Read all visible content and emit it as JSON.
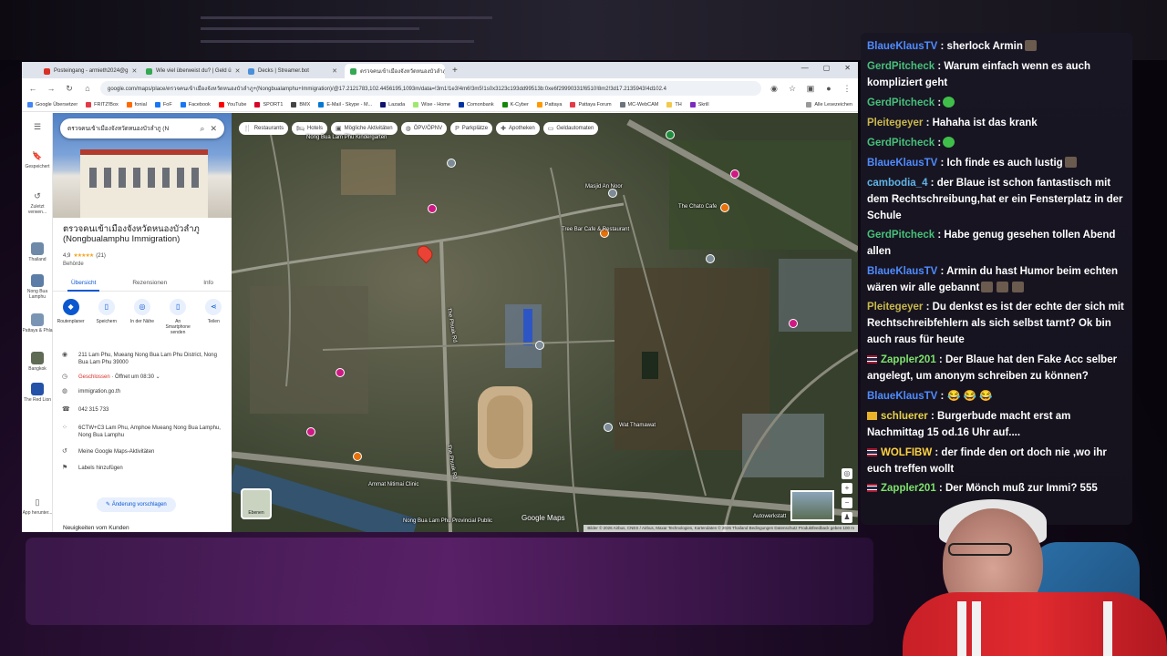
{
  "browser": {
    "tabs": [
      {
        "label": "Posteingang - armieth2024@g",
        "color": "#d93025"
      },
      {
        "label": "Wie viel überweist du? | Geld ü",
        "color": "#34a853"
      },
      {
        "label": "Decks | Streamer.bot",
        "color": "#4a90d9"
      },
      {
        "label": "ตรวจคนเข้าเมืองจังหวัดหนองบัวลำภู",
        "color": "#34a853"
      }
    ],
    "url": "google.com/maps/place/ตรวจคนเข้าเมืองจังหวัดหนองบัวลำภู+(Nongbualamphu+Immigration)/@17.2121783,102.4456195,1093m/data=!3m1!1e3!4m6!3m5!1s0x3123c193dd99513b:0xe6f29990331f6510!8m2!3d17.2135943!4d102.4",
    "bookmarks": [
      "Google Übersetzer",
      "FRITZ!Box",
      "fonial",
      "FoF",
      "Facebook",
      "YouTube",
      "SPORT1",
      "BMX",
      "E-Mail - Skype - M...",
      "Lazada",
      "Wise - Home",
      "Comonbank",
      "K-Cyber",
      "Pattaya",
      "Pattaya Forum",
      "MC-WebCAM",
      "TH",
      "Skrill",
      "Alle Lesezeichen"
    ]
  },
  "maps": {
    "rail": [
      {
        "label": "Gespeichert",
        "icon": "bookmark-icon"
      },
      {
        "label": "Zuletzt verwen...",
        "icon": "history-icon"
      },
      {
        "label": "Thailand",
        "icon": "place-thumb"
      },
      {
        "label": "Nong Bua Lamphu",
        "icon": "place-thumb"
      },
      {
        "label": "Pattaya & Phla",
        "icon": "place-thumb"
      },
      {
        "label": "Bangkok",
        "icon": "place-thumb"
      },
      {
        "label": "The Red Lion",
        "icon": "place-thumb"
      },
      {
        "label": "App herunter...",
        "icon": "phone-icon"
      }
    ],
    "search_query": "ตรวจคนเข้าเมืองจังหวัดหนองบัวลำภู (N",
    "place": {
      "title": "ตรวจคนเข้าเมืองจังหวัดหนองบัวลำภู (Nongbualamphu Immigration)",
      "rating": "4,9",
      "stars": "★★★★★",
      "reviews": "(21)",
      "category": "Behörde",
      "tabs": [
        "Übersicht",
        "Rezensionen",
        "Info"
      ],
      "actions": [
        "Routenplaner",
        "Speichern",
        "In der Nähe",
        "An Smartphone senden",
        "Teilen"
      ],
      "address": "211 Lam Phu, Mueang Nong Bua Lam Phu District, Nong Bua Lam Phu 39000",
      "status_closed": "Geschlossen",
      "status_opens": " · Öffnet um 08:30",
      "website": "immigration.go.th",
      "phone": "042 315 733",
      "pluscode": "6CTW+C3 Lam Phu, Amphoe Mueang Nong Bua Lamphu, Nong Bua Lamphu",
      "activity": "Meine Google Maps-Aktivitäten",
      "labels": "Labels hinzufügen",
      "suggest": "Änderung vorschlagen",
      "nearby": "Neuigkeiten vom Kunden"
    },
    "chips": [
      "Restaurants",
      "Hotels",
      "Mögliche Aktivitäten",
      "ÖPV/ÖPNV",
      "Parkplätze",
      "Apotheken",
      "Geldautomaten"
    ],
    "labels": [
      "Nong Bua Lam Phu Kindergarten",
      "Masjid An Noor",
      "Tree Bar Cafe & Restaurant",
      "The Chato Cafe",
      "Wat Thamawat",
      "Ammat Nitimai Clinic",
      "The Phuak Rd",
      "The Phuak Rd",
      "Nong Bua Lam Phu Provincial Public",
      "Autowerkstatt"
    ],
    "layers_label": "Ebenen",
    "logo": "Google Maps",
    "attribution": "Bilder © 2026 Airbus, CNES / Airbus, Maxar Technologies, Kartendaten © 2026   Thailand   Bedingungen   Datenschutz   Produktfeedback geben   100 m"
  },
  "chat": [
    {
      "user": "BlaueKlausTV",
      "color": "#4f8cff",
      "text": " : sherlock Armin",
      "emotes": 1,
      "flag": false
    },
    {
      "user": "GerdPitcheck",
      "color": "#46c17a",
      "text": " : Warum einfach wenn es auch kompliziert geht",
      "emotes": 0,
      "flag": false
    },
    {
      "user": "GerdPitcheck",
      "color": "#46c17a",
      "text": " :",
      "emotes": 1,
      "flag": false,
      "green": true
    },
    {
      "user": "Pleitegeyer",
      "color": "#c9b84a",
      "text": " : Hahaha ist das krank",
      "emotes": 0,
      "flag": false
    },
    {
      "user": "GerdPitcheck",
      "color": "#46c17a",
      "text": " :",
      "emotes": 1,
      "flag": false,
      "green": true
    },
    {
      "user": "BlaueKlausTV",
      "color": "#4f8cff",
      "text": " : Ich finde es auch lustig",
      "emotes": 1,
      "flag": false
    },
    {
      "user": "cambodia_4",
      "color": "#5fb4e6",
      "text": " : der Blaue ist schon fantastisch mit dem Rechtschreibung,hat er ein Fensterplatz in der Schule",
      "emotes": 0,
      "flag": false
    },
    {
      "user": "GerdPitcheck",
      "color": "#46c17a",
      "text": " : Habe genug gesehen tollen Abend allen",
      "emotes": 0,
      "flag": false
    },
    {
      "user": "BlaueKlausTV",
      "color": "#4f8cff",
      "text": " : Armin du hast Humor beim echten wären wir alle gebannt",
      "emotes": 3,
      "flag": false
    },
    {
      "user": "Pleitegeyer",
      "color": "#c9b84a",
      "text": " : Du denkst es ist der echte der sich mit Rechtschreibfehlern als sich selbst tarnt? Ok bin auch raus für heute",
      "emotes": 0,
      "flag": false
    },
    {
      "user": "Zappler201",
      "color": "#7de36b",
      "text": " : Der Blaue hat den Fake Acc selber angelegt, um anonym schreiben zu können?",
      "emotes": 0,
      "flag": true
    },
    {
      "user": "BlaueKlausTV",
      "color": "#4f8cff",
      "text": " :",
      "emotes": 0,
      "flag": false,
      "laughs": "😂 😂 😂"
    },
    {
      "user": "schluerer",
      "color": "#e8d24a",
      "text": " : Burgerbude macht erst am Nachmittag 15 od.16 Uhr auf....",
      "emotes": 0,
      "flag": false,
      "crown": true
    },
    {
      "user": "WOLFIBW",
      "color": "#ffd23f",
      "text": " : der finde den ort doch nie ,wo ihr euch treffen wollt",
      "emotes": 0,
      "flag": true
    },
    {
      "user": "Zappler201",
      "color": "#7de36b",
      "text": " : Der Mönch muß zur Immi? 555",
      "emotes": 0,
      "flag": true
    }
  ]
}
